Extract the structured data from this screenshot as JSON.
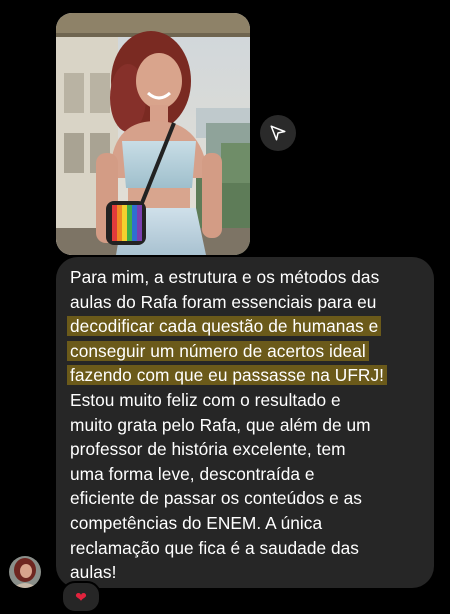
{
  "message": {
    "lines": [
      "Para mim, a estrutura e os métodos das",
      "aulas do Rafa foram essenciais para eu",
      "decodificar cada questão de humanas e",
      "conseguir um número de acertos ideal",
      "fazendo com que eu passasse na UFRJ!",
      "Estou muito feliz com o resultado e",
      "muito grata pelo Rafa, que além de um",
      "professor de história excelente, tem",
      "uma forma leve, descontraída e",
      "eficiente de passar os conteúdos e as",
      "competências do ENEM. A única",
      "reclamação que fica é a saudade das",
      "aulas!"
    ],
    "highlighted_lines": [
      2,
      3,
      4
    ],
    "highlight_color": "#6b5a1a",
    "bubble_color": "#262626",
    "text_color": "#ffffff"
  },
  "reaction": {
    "icon": "heart-icon",
    "glyph": "❤"
  },
  "share": {
    "icon": "send-icon"
  },
  "colors": {
    "background": "#000000"
  }
}
